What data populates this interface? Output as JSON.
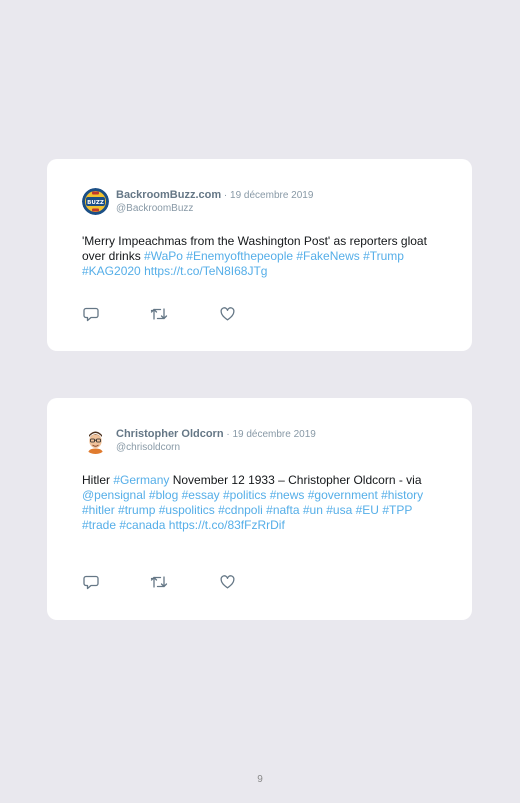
{
  "tweets": [
    {
      "name": "BackroomBuzz.com",
      "separator": " · ",
      "date": "19 décembre 2019",
      "handle": "@BackroomBuzz",
      "avatar_icon": "backroombuzz-logo",
      "segments": [
        {
          "text": "'Merry Impeachmas from the Washington Post' as reporters gloat over drinks ",
          "link": false
        },
        {
          "text": "#WaPo",
          "link": true
        },
        {
          "text": " ",
          "link": false
        },
        {
          "text": "#Enemyofthepeople",
          "link": true
        },
        {
          "text": " ",
          "link": false
        },
        {
          "text": "#FakeNews",
          "link": true
        },
        {
          "text": " ",
          "link": false
        },
        {
          "text": "#Trump",
          "link": true
        },
        {
          "text": " ",
          "link": false
        },
        {
          "text": "#KAG2020",
          "link": true
        },
        {
          "text": " ",
          "link": false
        },
        {
          "text": "https://t.co/TeN8I68JTg",
          "link": true
        }
      ]
    },
    {
      "name": "Christopher Oldcorn",
      "separator": " · ",
      "date": "19 décembre 2019",
      "handle": "@chrisoldcorn",
      "avatar_icon": "bitmoji-avatar",
      "segments": [
        {
          "text": "Hitler ",
          "link": false
        },
        {
          "text": "#Germany",
          "link": true
        },
        {
          "text": " November 12 1933 – Christopher Oldcorn - via ",
          "link": false
        },
        {
          "text": "@pensignal",
          "link": true
        },
        {
          "text": " ",
          "link": false
        },
        {
          "text": "#blog",
          "link": true
        },
        {
          "text": " ",
          "link": false
        },
        {
          "text": "#essay",
          "link": true
        },
        {
          "text": " ",
          "link": false
        },
        {
          "text": "#politics",
          "link": true
        },
        {
          "text": " ",
          "link": false
        },
        {
          "text": "#news",
          "link": true
        },
        {
          "text": " ",
          "link": false
        },
        {
          "text": "#government",
          "link": true
        },
        {
          "text": " ",
          "link": false
        },
        {
          "text": "#history",
          "link": true
        },
        {
          "text": " ",
          "link": false
        },
        {
          "text": "#hitler",
          "link": true
        },
        {
          "text": " ",
          "link": false
        },
        {
          "text": "#trump",
          "link": true
        },
        {
          "text": " ",
          "link": false
        },
        {
          "text": "#uspolitics",
          "link": true
        },
        {
          "text": " ",
          "link": false
        },
        {
          "text": "#cdnpoli",
          "link": true
        },
        {
          "text": " ",
          "link": false
        },
        {
          "text": "#nafta",
          "link": true
        },
        {
          "text": " ",
          "link": false
        },
        {
          "text": "#un",
          "link": true
        },
        {
          "text": " ",
          "link": false
        },
        {
          "text": "#usa",
          "link": true
        },
        {
          "text": " ",
          "link": false
        },
        {
          "text": "#EU",
          "link": true
        },
        {
          "text": " ",
          "link": false
        },
        {
          "text": "#TPP",
          "link": true
        },
        {
          "text": " ",
          "link": false
        },
        {
          "text": "#trade",
          "link": true
        },
        {
          "text": " ",
          "link": false
        },
        {
          "text": "#canada",
          "link": true
        },
        {
          "text": " ",
          "link": false
        },
        {
          "text": "https://t.co/83fFzRrDif",
          "link": true
        }
      ]
    }
  ],
  "actions": {
    "reply_icon": "reply-icon",
    "retweet_icon": "retweet-icon",
    "like_icon": "heart-icon"
  },
  "colors": {
    "background": "#e9e8ee",
    "card": "#ffffff",
    "link": "#55aee8",
    "muted": "#8899a6",
    "name": "#657786",
    "icon": "#657786"
  },
  "page_number": "9"
}
